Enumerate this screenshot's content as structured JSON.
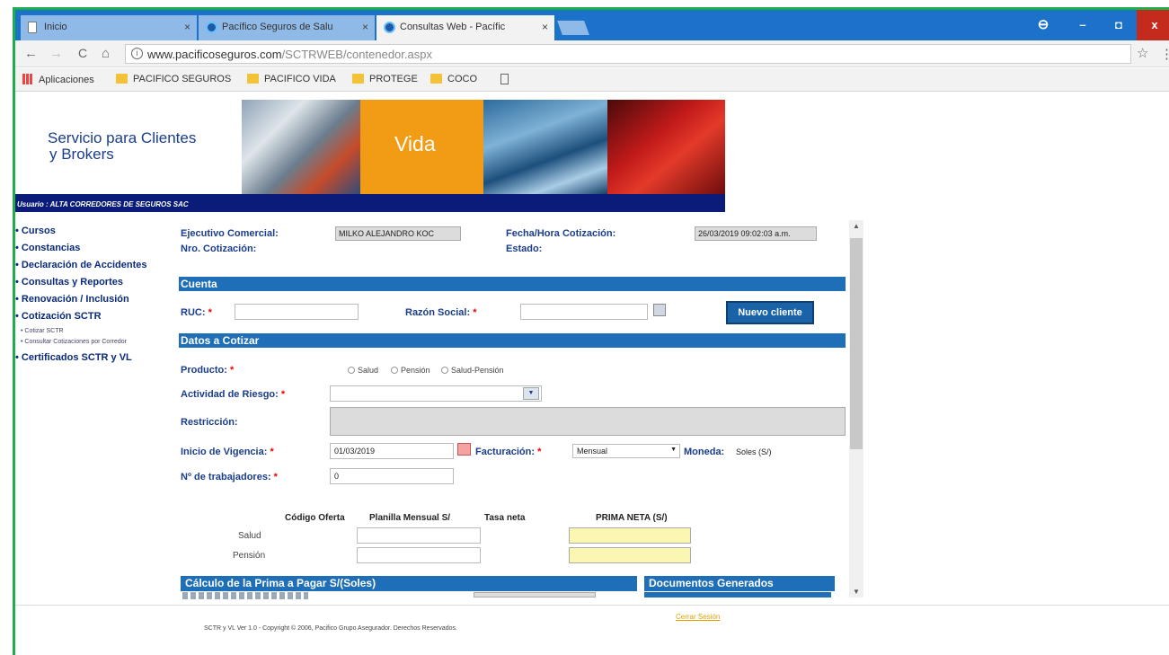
{
  "browser": {
    "tabs": [
      {
        "label": "Inicio",
        "close": "×"
      },
      {
        "label": "Pacífico Seguros de Salu",
        "close": "×"
      },
      {
        "label": "Consultas Web - Pacífic",
        "close": "×"
      }
    ],
    "window": {
      "account": "⊖",
      "minimize": "–",
      "restore": "◘",
      "close": "x"
    },
    "nav": {
      "back": "←",
      "forward": "→",
      "reload": "C",
      "home": "⌂"
    },
    "url": {
      "host": "www.pacificoseguros.com",
      "path": "/SCTRWEB/contenedor.aspx"
    },
    "star": "☆",
    "menu": "⋮",
    "bookmarks": [
      "Aplicaciones",
      "PACIFICO SEGUROS",
      "PACIFICO VIDA",
      "PROTEGE",
      "COCO"
    ]
  },
  "banner": {
    "brand_line1": "Servicio para Clientes",
    "brand_line2": "y Brokers",
    "vida": "Vida",
    "user": "Usuario : ALTA CORREDORES DE SEGUROS SAC"
  },
  "sidebar": {
    "items": [
      "• Cursos",
      "• Constancias",
      "• Declaración de Accidentes",
      "• Consultas y Reportes",
      "• Renovación / Inclusión",
      "• Cotización SCTR"
    ],
    "subitems": [
      "• Cotizar SCTR",
      "• Consultar Cotizaciones por Corredor"
    ],
    "last": "• Certificados SCTR y VL"
  },
  "form": {
    "ejecutivo_label": "Ejecutivo Comercial:",
    "ejecutivo_value": "MILKO ALEJANDRO KOC",
    "fecha_label": "Fecha/Hora Cotización:",
    "fecha_value": "26/03/2019 09:02:03 a.m.",
    "nro_label": "Nro. Cotización:",
    "estado_label": "Estado:",
    "cuenta_section": "Cuenta",
    "ruc_label": "RUC:",
    "razon_label": "Razón Social:",
    "nuevo_cliente": "Nuevo cliente",
    "datos_section": "Datos a Cotizar",
    "producto_label": "Producto:",
    "producto_options": [
      "Salud",
      "Pensión",
      "Salud-Pensión"
    ],
    "actividad_label": "Actividad de Riesgo:",
    "restriccion_label": "Restricción:",
    "inicio_label": "Inicio de Vigencia:",
    "inicio_value": "01/03/2019",
    "facturacion_label": "Facturación:",
    "facturacion_value": "Mensual",
    "moneda_label": "Moneda:",
    "moneda_value": "Soles (S/)",
    "trabajadores_label": "Nº de trabajadores:",
    "trabajadores_value": "0",
    "req": "*",
    "table_headers": [
      "Código Oferta",
      "Planilla Mensual S/",
      "Tasa neta",
      "PRIMA NETA (S/)"
    ],
    "rows": [
      "Salud",
      "Pensión"
    ],
    "calculo_section": "Cálculo de la Prima a Pagar S/(Soles)",
    "documentos_section": "Documentos Generados"
  },
  "footer": {
    "copyright": "SCTR y VL Ver 1.0 - Copyright © 2006, Pacifico Grupo Asegurador. Derechos Reservados.",
    "logout": "Cerrar Sesión"
  }
}
